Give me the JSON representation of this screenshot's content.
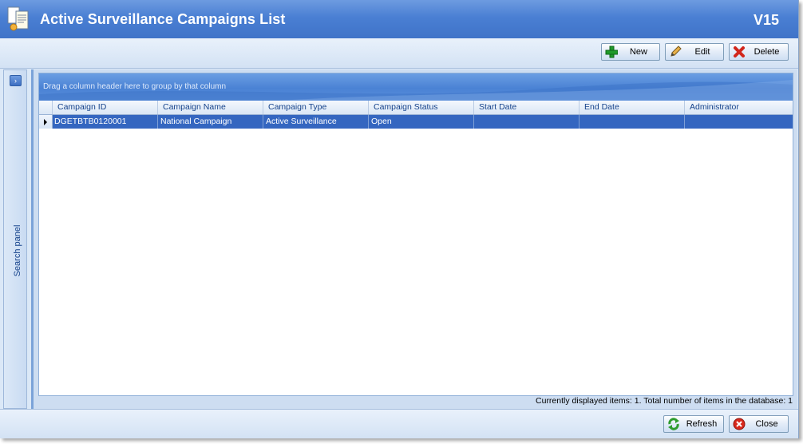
{
  "window": {
    "title": "Active Surveillance Campaigns List",
    "version": "V15"
  },
  "toolbar": {
    "new_label": "New",
    "edit_label": "Edit",
    "delete_label": "Delete"
  },
  "side_panel": {
    "label": "Search panel"
  },
  "grid": {
    "group_by_hint": "Drag a column header here to group by that column",
    "columns": [
      "Campaign ID",
      "Campaign Name",
      "Campaign Type",
      "Campaign Status",
      "Start Date",
      "End Date",
      "Administrator"
    ],
    "rows": [
      {
        "campaign_id": "DGETBTB0120001",
        "campaign_name": "National Campaign",
        "campaign_type": "Active Surveillance",
        "campaign_status": "Open",
        "start_date": "",
        "end_date": "",
        "administrator": ""
      }
    ],
    "status_text": "Currently displayed items: 1. Total number of items in the database: 1"
  },
  "footer": {
    "refresh_label": "Refresh",
    "close_label": "Close"
  },
  "colors": {
    "title_bar": "#4a7fd3",
    "selected_row": "#3466c0",
    "header_text": "#15428b"
  },
  "icons": {
    "app": "document-list-icon",
    "new": "green-plus-icon",
    "edit": "pencil-icon",
    "delete": "red-x-icon",
    "refresh": "green-refresh-icon",
    "close": "red-close-circle-icon",
    "expand": "chevron-right-icon"
  }
}
